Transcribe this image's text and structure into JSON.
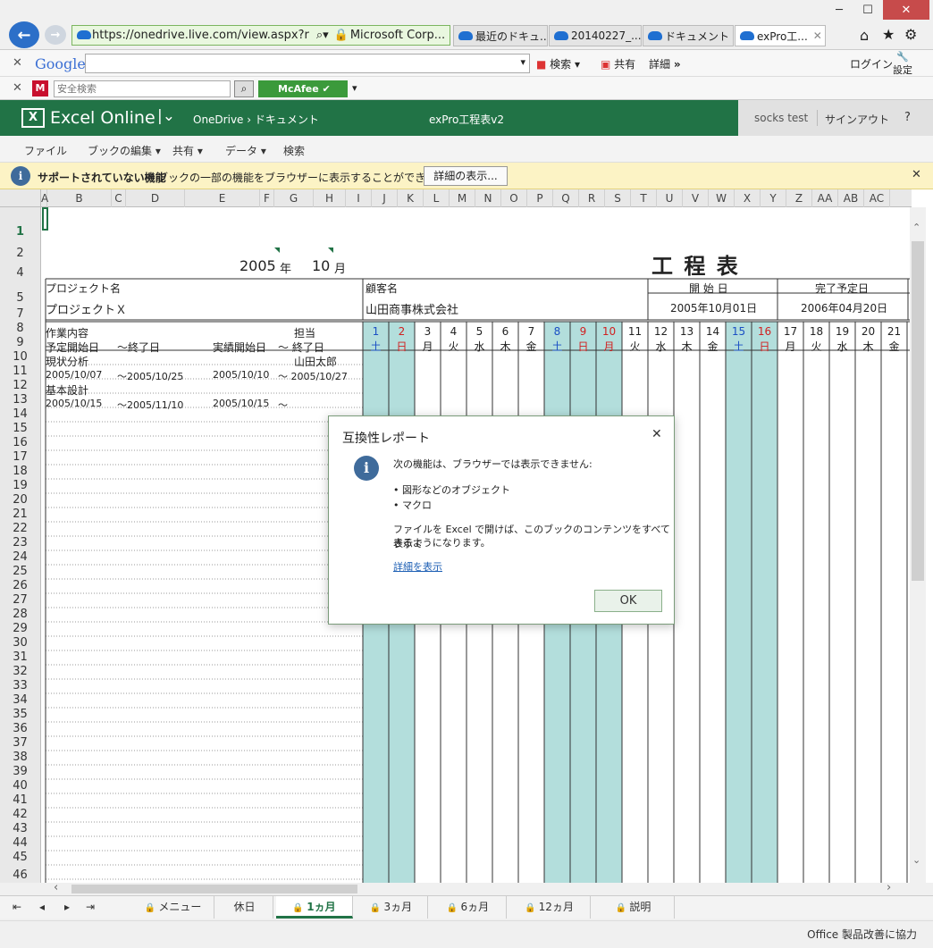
{
  "browser": {
    "url": "https://onedrive.live.com/view.aspx?r",
    "site_identity": "Microsoft Corp...",
    "tabs": [
      {
        "label": "最近のドキュ..."
      },
      {
        "label": "20140227_..."
      },
      {
        "label": "ドキュメント - ..."
      },
      {
        "label": "exPro工..."
      }
    ],
    "google_toolbar": {
      "logo": "Google",
      "search_label": "検索",
      "share_label": "共有",
      "more_label": "詳細",
      "more_chevron": "»",
      "login_label": "ログイン",
      "settings_label": "設定"
    },
    "mcafee_toolbar": {
      "search_placeholder": "安全検索",
      "brand": "McAfee"
    }
  },
  "excel": {
    "app_name": "Excel Online",
    "breadcrumb_root": "OneDrive",
    "breadcrumb_sep": "›",
    "breadcrumb_folder": "ドキュメント",
    "doc_title": "exPro工程表v2",
    "user_name": "socks test",
    "signout": "サインアウト",
    "help": "?",
    "ribbon": [
      "ファイル",
      "ブックの編集 ▾",
      "共有 ▾",
      "データ ▾",
      "検索"
    ],
    "notice": {
      "title": "サポートされていない機能",
      "text": "ブックの一部の機能をブラウザーに表示することができません。",
      "button": "詳細の表示..."
    },
    "columns": [
      "A",
      "B",
      "C",
      "D",
      "E",
      "F",
      "G",
      "H",
      "I",
      "J",
      "K",
      "L",
      "M",
      "N",
      "O",
      "P",
      "Q",
      "R",
      "S",
      "T",
      "U",
      "V",
      "W",
      "X",
      "Y",
      "Z",
      "AA",
      "AB",
      "AC"
    ],
    "rows": [
      "1",
      "2",
      "4",
      "5",
      "7",
      "8",
      "9",
      "10",
      "11",
      "12",
      "13",
      "14",
      "15",
      "16",
      "17",
      "18",
      "19",
      "20",
      "21",
      "22",
      "23",
      "24",
      "25",
      "26",
      "27",
      "28",
      "29",
      "30",
      "31",
      "32",
      "33",
      "34",
      "35",
      "36",
      "37",
      "38",
      "39",
      "40",
      "41",
      "42",
      "43",
      "44",
      "45",
      "46"
    ]
  },
  "sheet": {
    "year": "2005",
    "year_unit": "年",
    "month": "10",
    "month_unit": "月",
    "title": "工 程 表",
    "project_label": "プロジェクト名",
    "project_value": "プロジェクトＸ",
    "client_label": "顧客名",
    "client_value": "山田商事株式会社",
    "start_label": "開 始 日",
    "start_value": "2005年10月01日",
    "end_label": "完了予定日",
    "end_value": "2006年04月20日",
    "hdr_task": "作業内容",
    "hdr_owner": "担当",
    "hdr_plan_start": "予定開始日",
    "hdr_plan_end": "～終了日",
    "hdr_act_start": "実績開始日",
    "hdr_act_end": "～ 終了日",
    "tasks": [
      {
        "name": "現状分析",
        "owner": "山田太郎",
        "plan_start": "2005/10/07",
        "plan_end": "～2005/10/25",
        "act_start": "2005/10/10",
        "act_end": "～ 2005/10/27"
      },
      {
        "name": "基本設計",
        "owner": "",
        "plan_start": "2005/10/15",
        "plan_end": "～2005/11/10",
        "act_start": "2005/10/15",
        "act_end": "～"
      }
    ],
    "days": [
      {
        "d": "1",
        "w": "土",
        "c": "#1a4fc4",
        "hl": true
      },
      {
        "d": "2",
        "w": "日",
        "c": "#d02020",
        "hl": true
      },
      {
        "d": "3",
        "w": "月",
        "c": "#222222",
        "hl": false
      },
      {
        "d": "4",
        "w": "火",
        "c": "#222222",
        "hl": false
      },
      {
        "d": "5",
        "w": "水",
        "c": "#222222",
        "hl": false
      },
      {
        "d": "6",
        "w": "木",
        "c": "#222222",
        "hl": false
      },
      {
        "d": "7",
        "w": "金",
        "c": "#222222",
        "hl": false
      },
      {
        "d": "8",
        "w": "土",
        "c": "#1a4fc4",
        "hl": true
      },
      {
        "d": "9",
        "w": "日",
        "c": "#d02020",
        "hl": true
      },
      {
        "d": "10",
        "w": "月",
        "c": "#d02020",
        "hl": true
      },
      {
        "d": "11",
        "w": "火",
        "c": "#222222",
        "hl": false
      },
      {
        "d": "12",
        "w": "水",
        "c": "#222222",
        "hl": false
      },
      {
        "d": "13",
        "w": "木",
        "c": "#222222",
        "hl": false
      },
      {
        "d": "14",
        "w": "金",
        "c": "#222222",
        "hl": false
      },
      {
        "d": "15",
        "w": "土",
        "c": "#1a4fc4",
        "hl": true
      },
      {
        "d": "16",
        "w": "日",
        "c": "#d02020",
        "hl": true
      },
      {
        "d": "17",
        "w": "月",
        "c": "#222222",
        "hl": false
      },
      {
        "d": "18",
        "w": "火",
        "c": "#222222",
        "hl": false
      },
      {
        "d": "19",
        "w": "水",
        "c": "#222222",
        "hl": false
      },
      {
        "d": "20",
        "w": "木",
        "c": "#222222",
        "hl": false
      },
      {
        "d": "21",
        "w": "金",
        "c": "#222222",
        "hl": false
      }
    ]
  },
  "sheet_tabs": [
    "メニュー",
    "休日",
    "1ヵ月",
    "3ヵ月",
    "6ヵ月",
    "12ヵ月",
    "説明"
  ],
  "active_sheet_tab": "1ヵ月",
  "status_text": "Office 製品改善に協力",
  "dialog": {
    "title": "互換性レポート",
    "intro": "次の機能は、ブラウザーでは表示できません:",
    "items": [
      "図形などのオブジェクト",
      "マクロ"
    ],
    "body_line1": "ファイルを Excel で開けば、このブックのコンテンツをすべて表示で",
    "body_line2": "きるようになります。",
    "link": "詳細を表示",
    "ok": "OK"
  },
  "colors": {
    "excel_green": "#217346",
    "weekend_fill": "#b3dedc",
    "notice_bg": "#fcf3c5"
  }
}
